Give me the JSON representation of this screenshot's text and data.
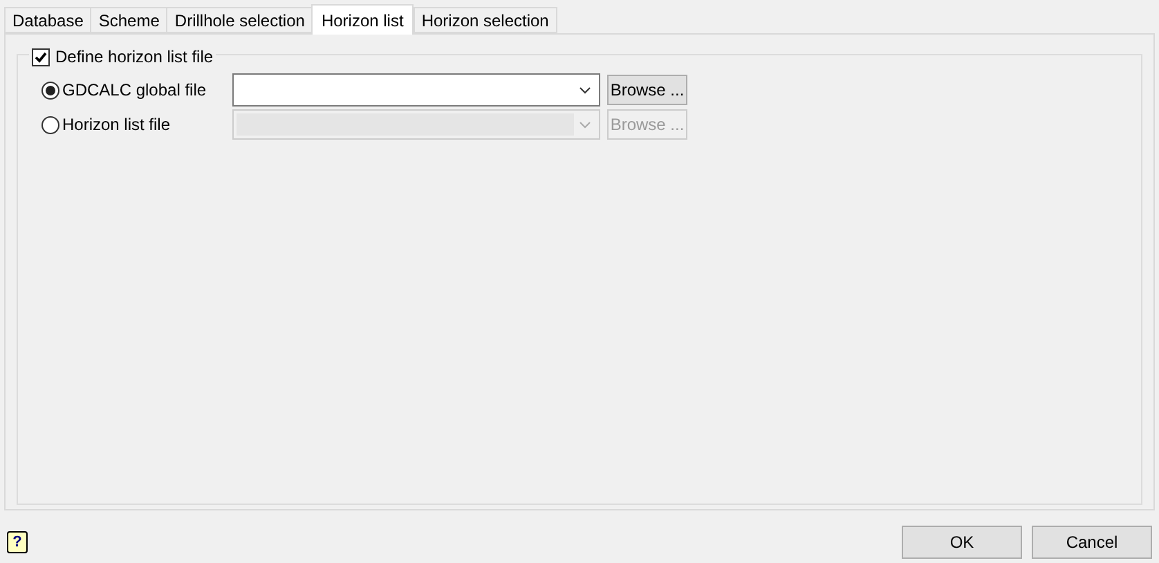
{
  "tabs": [
    {
      "label": "Database",
      "selected": false
    },
    {
      "label": "Scheme",
      "selected": false
    },
    {
      "label": "Drillhole selection",
      "selected": false
    },
    {
      "label": "Horizon list",
      "selected": true
    },
    {
      "label": "Horizon selection",
      "selected": false
    }
  ],
  "group": {
    "label": "Define horizon list file",
    "checked": true
  },
  "options": [
    {
      "label": "GDCALC global file",
      "selected": true,
      "disabled": false,
      "browse": "Browse ..."
    },
    {
      "label": "Horizon list file",
      "selected": false,
      "disabled": true,
      "browse": "Browse ..."
    }
  ],
  "help": "?",
  "buttons": [
    "OK",
    "Cancel"
  ]
}
